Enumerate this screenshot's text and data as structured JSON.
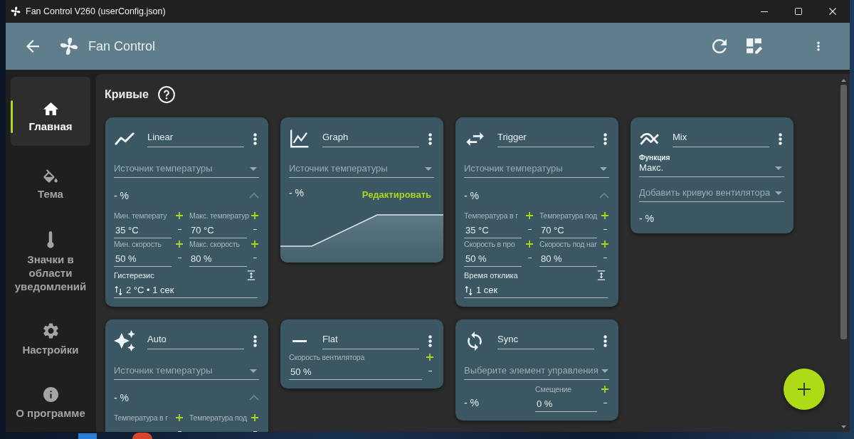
{
  "window": {
    "title": "Fan Control V260 (userConfig.json)"
  },
  "app_bar": {
    "title": "Fan Control"
  },
  "sidebar": {
    "items": [
      {
        "label": "Главная",
        "selected": true
      },
      {
        "label": "Тема",
        "selected": false
      },
      {
        "label": "Значки в области уведомлений",
        "selected": false
      },
      {
        "label": "Настройки",
        "selected": false
      },
      {
        "label": "О программе",
        "selected": false
      }
    ]
  },
  "page": {
    "title": "Кривые"
  },
  "cards": [
    {
      "kind": "linear",
      "name": "Linear",
      "source": {
        "placeholder": "Источник температуры"
      },
      "reading": "- %",
      "expanded": true,
      "fields": [
        {
          "label": "Мин. температу",
          "value": "35 °C"
        },
        {
          "label": "Макс. температур",
          "value": "70 °C"
        },
        {
          "label": "Мин. скорость",
          "value": "50 %"
        },
        {
          "label": "Макс. скорость",
          "value": "80 %"
        }
      ],
      "extra": {
        "label": "Гистерезис",
        "value": "2 °C • 1 сек"
      }
    },
    {
      "kind": "graph",
      "name": "Graph",
      "source": {
        "placeholder": "Источник температуры"
      },
      "reading": "- %",
      "edit_button": "Редактировать"
    },
    {
      "kind": "trigger",
      "name": "Trigger",
      "source": {
        "placeholder": "Источник температуры"
      },
      "reading": "- %",
      "expanded": true,
      "fields": [
        {
          "label": "Температура в г",
          "value": "35 °C"
        },
        {
          "label": "Температура под",
          "value": "70 °C"
        },
        {
          "label": "Скорость в про",
          "value": "50 %"
        },
        {
          "label": "Скорость под наг",
          "value": "80 %"
        }
      ],
      "extra": {
        "label": "Время отклика",
        "value": "1 сек"
      }
    },
    {
      "kind": "mix",
      "name": "Mix",
      "function": {
        "label": "Функция",
        "value": "Макс."
      },
      "add_curve": {
        "placeholder": "Добавить кривую вентилятора"
      },
      "reading": "- %"
    },
    {
      "kind": "auto",
      "name": "Auto",
      "source": {
        "placeholder": "Источник температуры"
      },
      "reading": "- %",
      "expanded": true,
      "fields": [
        {
          "label": "Температура в г"
        },
        {
          "label": "Температура под"
        }
      ]
    },
    {
      "kind": "flat",
      "name": "Flat",
      "fields": [
        {
          "label": "Скорость вентилятора",
          "value": "50 %"
        }
      ]
    },
    {
      "kind": "sync",
      "name": "Sync",
      "control": {
        "placeholder": "Выберите элемент управления"
      },
      "reading": "- %",
      "fields": [
        {
          "label": "Смещение",
          "value": "0 %"
        }
      ]
    }
  ]
}
